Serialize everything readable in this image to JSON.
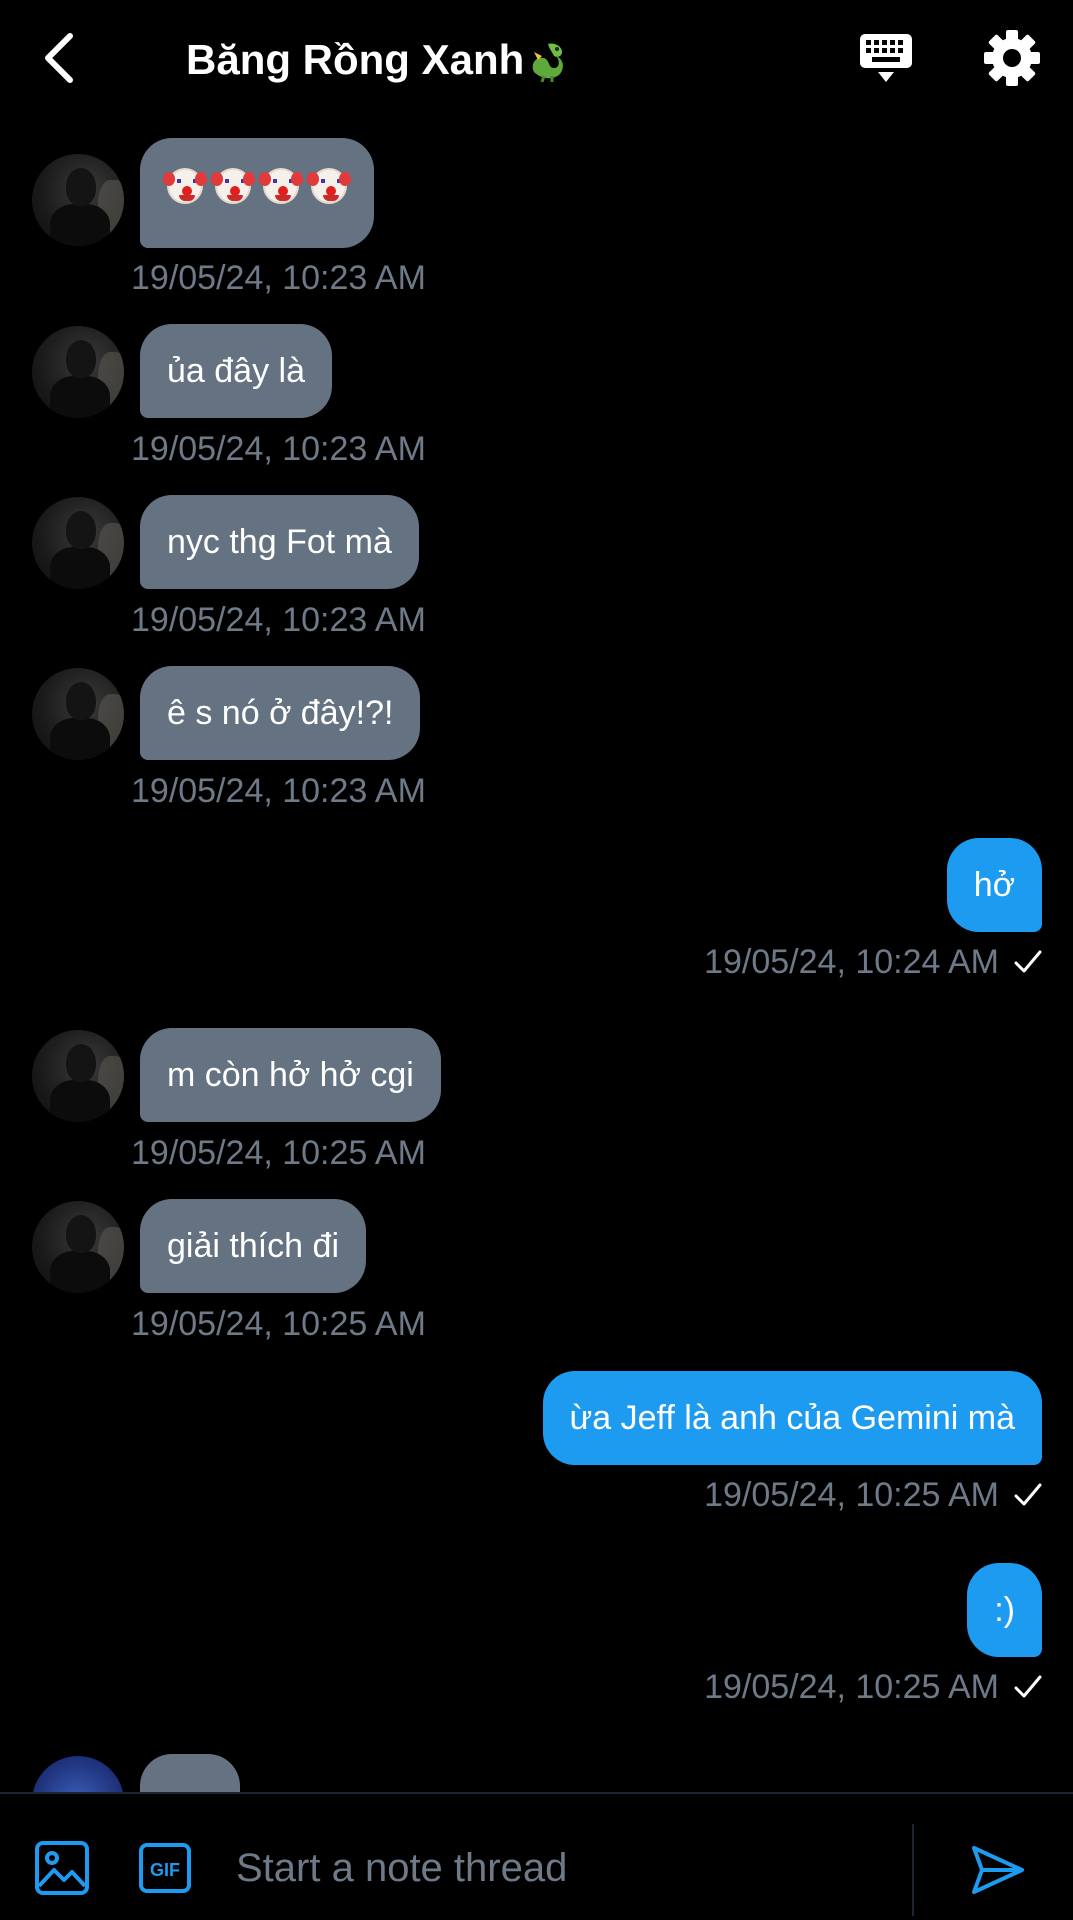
{
  "header": {
    "title": "Băng Rồng Xanh",
    "back_icon": "chevron-left-icon",
    "keyboard_icon": "keyboard-icon",
    "settings_icon": "gear-icon"
  },
  "colors": {
    "background": "#000000",
    "incoming_bubble": "#647282",
    "outgoing_bubble": "#1d9bf0",
    "timestamp": "#6e7a88",
    "text": "#ffffff"
  },
  "messages": [
    {
      "direction": "in",
      "text": "🤡🤡🤡🤡",
      "timestamp": "19/05/24, 10:23 AM"
    },
    {
      "direction": "in",
      "text": "ủa đây là",
      "timestamp": "19/05/24, 10:23 AM"
    },
    {
      "direction": "in",
      "text": "nyc thg Fot mà",
      "timestamp": "19/05/24, 10:23 AM"
    },
    {
      "direction": "in",
      "text": "ê s nó ở đây!?!",
      "timestamp": "19/05/24, 10:23 AM"
    },
    {
      "direction": "out",
      "text": "hở",
      "timestamp": "19/05/24, 10:24 AM",
      "status": "sent"
    },
    {
      "direction": "in",
      "text": "m còn hở hở cgi",
      "timestamp": "19/05/24, 10:25 AM"
    },
    {
      "direction": "in",
      "text": "giải thích đi",
      "timestamp": "19/05/24, 10:25 AM"
    },
    {
      "direction": "out",
      "text": "ừa Jeff là anh của Gemini mà",
      "timestamp": "19/05/24, 10:25 AM",
      "status": "sent"
    },
    {
      "direction": "out",
      "text": ":)",
      "timestamp": "19/05/24, 10:25 AM",
      "status": "sent"
    }
  ],
  "composer": {
    "placeholder": "Start a note thread",
    "image_icon": "image-icon",
    "gif_label": "GIF",
    "send_icon": "send-icon"
  }
}
